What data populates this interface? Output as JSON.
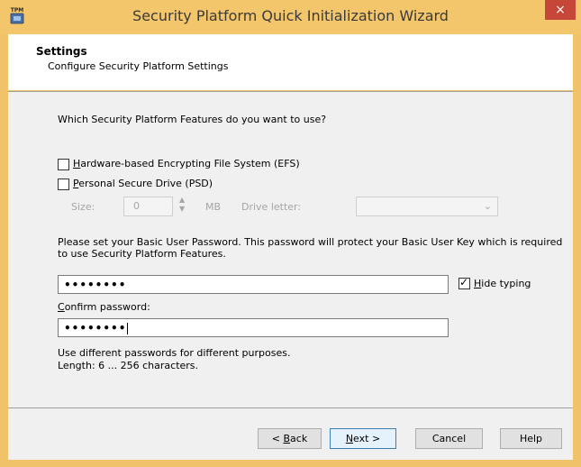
{
  "window": {
    "title": "Security Platform Quick Initialization Wizard",
    "icon_label": "TPM",
    "close_glyph": "×"
  },
  "header": {
    "title": "Settings",
    "subtitle": "Configure Security Platform Settings"
  },
  "content": {
    "question": "Which Security Platform Features do you want to use?",
    "efs": {
      "label_key": "H",
      "label_rest": "ardware-based Encrypting File System (EFS)",
      "checked": false
    },
    "psd": {
      "label_key": "P",
      "label_rest": "ersonal Secure Drive (PSD)",
      "checked": false
    },
    "size_label": "Size:",
    "size_value": "0",
    "size_unit": "MB",
    "drive_letter_label": "Drive letter:",
    "drive_letter_value": "",
    "password_prompt": "Please set your Basic User Password. This password will protect your Basic User Key which is required to use Security Platform Features.",
    "password_mask": "••••••••",
    "hide_typing": {
      "label_key": "H",
      "label_rest": "ide typing",
      "checked": true
    },
    "confirm_label_key": "C",
    "confirm_label_rest": "onfirm password:",
    "confirm_mask": "••••••••",
    "hint_line1": "Use different passwords for different purposes.",
    "hint_line2": "Length: 6 ... 256 characters."
  },
  "footer": {
    "back": {
      "prefix": "< ",
      "key": "B",
      "rest": "ack"
    },
    "next": {
      "key": "N",
      "rest": "ext >"
    },
    "cancel": "Cancel",
    "help": "Help"
  }
}
